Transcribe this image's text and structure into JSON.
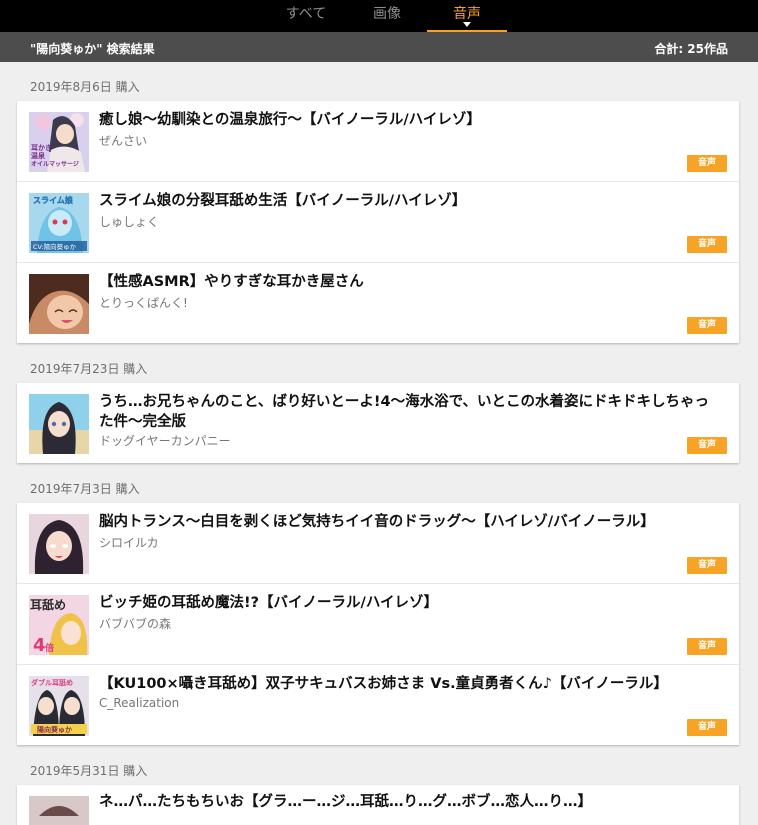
{
  "tabs": [
    {
      "label": "すべて"
    },
    {
      "label": "画像"
    },
    {
      "label": "音声"
    }
  ],
  "active_tab": 2,
  "search": {
    "query_label": "\"陽向葵ゅか\" 検索結果",
    "total": "合計: 25作品"
  },
  "badge_label": "音声",
  "groups": [
    {
      "date": "2019年8月6日 購入",
      "items": [
        {
          "title": "癒し娘～幼馴染との温泉旅行～【バイノーラル/ハイレゾ】",
          "circle": "ぜんさい"
        },
        {
          "title": "スライム娘の分裂耳舐め生活【バイノーラル/ハイレゾ】",
          "circle": "しゅしょく"
        },
        {
          "title": "【性感ASMR】やりすぎな耳かき屋さん",
          "circle": "とりっくぱんく!"
        }
      ]
    },
    {
      "date": "2019年7月23日 購入",
      "items": [
        {
          "title": "うち…お兄ちゃんのこと、ばり好いとーよ!4～海水浴で、いとこの水着姿にドキドキしちゃった件～完全版",
          "circle": "ドッグイヤーカンパニー"
        }
      ]
    },
    {
      "date": "2019年7月3日 購入",
      "items": [
        {
          "title": "脳内トランス～白目を剥くほど気持ちイイ音のドラッグ～【ハイレゾ/バイノーラル】",
          "circle": "シロイルカ"
        },
        {
          "title": "ビッチ姫の耳舐め魔法!?【バイノーラル/ハイレゾ】",
          "circle": "バブバブの森"
        },
        {
          "title": "【KU100×囁き耳舐め】双子サキュバスお姉さま Vs.童貞勇者くん♪【バイノーラル】",
          "circle": "C_Realization"
        }
      ]
    },
    {
      "date": "2019年5月31日 購入",
      "items": [
        {
          "title": "ネ…パ…たちもちいお【グラ…ー…ジ…耳舐…り…グ…ボブ…恋人…り…】",
          "circle": ""
        }
      ]
    }
  ],
  "thumb_texts": {
    "t1": "耳かき 温泉 オイルマッサージ",
    "t2": "スライム娘",
    "t2b": "CV:陽向葵ゅか",
    "t6": "耳舐め",
    "t6b": "4倍",
    "t7": "ダブル耳舐め",
    "t7b": "陽向葵ゅか"
  },
  "colors": {
    "accent": "#f7a325",
    "header_bg": "#000000",
    "result_bg": "#4d4d4d",
    "page_bg": "#efefef"
  }
}
